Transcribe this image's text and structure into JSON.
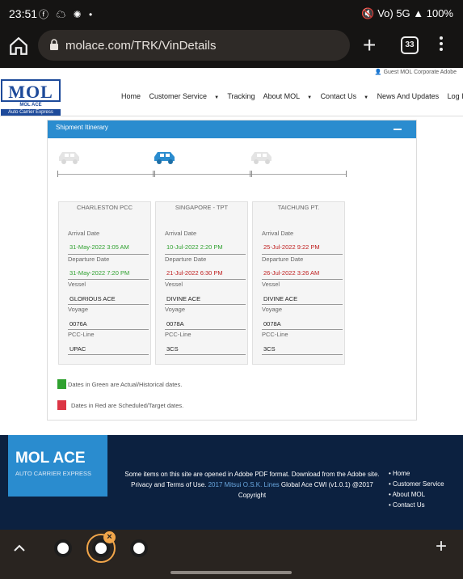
{
  "status_bar": {
    "time": "23:51",
    "left_icons": "ⓕ ☁ ✺ •",
    "right_icons": "🔇 Vo) 5G ▲ 100%"
  },
  "browser": {
    "url": "molace.com/TRK/VinDetails",
    "tab_count": "33"
  },
  "site": {
    "top_strip": "Guest  MOL Corporate  Adobe",
    "logo": {
      "main": "MOL",
      "sub": "MOL ACE",
      "sub2": "Auto Carrier Express"
    },
    "nav": {
      "home": "Home",
      "customer_service": "Customer Service",
      "tracking": "Tracking",
      "about": "About MOL",
      "contact": "Contact Us",
      "news": "News And Updates",
      "login": "Log In"
    }
  },
  "itinerary": {
    "title": "Shipment Itinerary",
    "labels": {
      "arrival": "Arrival Date",
      "departure": "Departure Date",
      "vessel": "Vessel",
      "voyage": "Voyage",
      "pcc_line": "PCC-Line"
    },
    "ports": [
      {
        "name": "CHARLESTON PCC",
        "arrival": "31-May-2022 3:05 AM",
        "arrival_status": "actual",
        "departure": "31-May-2022 7:20 PM",
        "departure_status": "actual",
        "vessel": "GLORIOUS ACE",
        "voyage": "0076A",
        "pcc_line": "UPAC"
      },
      {
        "name": "SINGAPORE - TPT",
        "arrival": "10-Jul-2022 2:20 PM",
        "arrival_status": "actual",
        "departure": "21-Jul-2022 6:30 PM",
        "departure_status": "scheduled",
        "vessel": "DIVINE ACE",
        "voyage": "0078A",
        "pcc_line": "3CS"
      },
      {
        "name": "TAICHUNG PT.",
        "arrival": "25-Jul-2022 9:22 PM",
        "arrival_status": "scheduled",
        "departure": "26-Jul-2022 3:26 AM",
        "departure_status": "scheduled",
        "vessel": "DIVINE ACE",
        "voyage": "0078A",
        "pcc_line": "3CS"
      }
    ],
    "legend": {
      "green_text": "Dates in Green are Actual/Historical dates.",
      "red_text": "Dates in Red are Scheduled/Target dates.",
      "green_color": "#2fa12f",
      "red_color": "#dc3545"
    }
  },
  "footer": {
    "logo_title": "MOL ACE",
    "logo_sub": "AUTO CARRIER EXPRESS",
    "text_line1": "Some items on this site are opened in Adobe PDF format. Download from the Adobe site.",
    "text_privacy": "Privacy and Terms of Use.",
    "text_link": "2017 Mitsui O.S.K. Lines",
    "text_rest": "Global Ace CWI (v1.0.1) @2017 Copyright",
    "links": [
      "Home",
      "Customer Service",
      "About MOL",
      "Contact Us"
    ]
  },
  "colors": {
    "accent": "#2a8ccf",
    "footer_bg": "#0c2140",
    "brand": "#1d4a9a"
  }
}
